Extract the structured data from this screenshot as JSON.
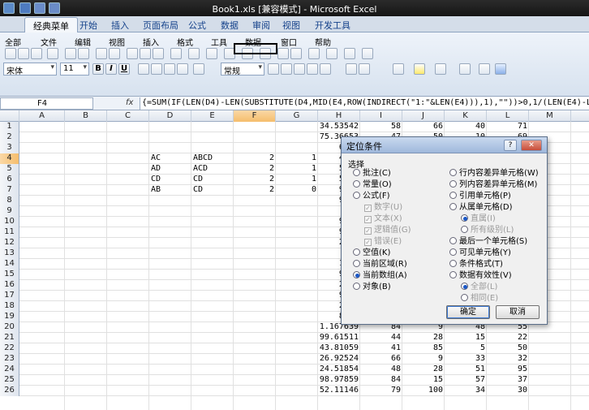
{
  "window": {
    "title": "Book1.xls  [兼容模式] - Microsoft Excel"
  },
  "ribbon_tabs": [
    "经典菜单",
    "开始",
    "插入",
    "页面布局",
    "公式",
    "数据",
    "审阅",
    "视图",
    "开发工具"
  ],
  "menus": [
    "全部",
    "文件",
    "编辑",
    "视图",
    "插入",
    "格式",
    "工具",
    "数据",
    "窗口",
    "帮助"
  ],
  "toolbar": {
    "font_name": "宋体",
    "font_size": "11",
    "number_format": "常规",
    "bold": "B",
    "italic": "I",
    "underline": "U"
  },
  "formula_bar": {
    "cell_ref": "F4",
    "fx": "fx",
    "formula": "{=SUM(IF(LEN(D4)-LEN(SUBSTITUTE(D4,MID(E4,ROW(INDIRECT(\"1:\"&LEN(E4))),1),\"\"))>0,1/(LEN(E4)-LEN"
  },
  "columns": [
    "A",
    "B",
    "C",
    "D",
    "E",
    "F",
    "G",
    "H",
    "I",
    "J",
    "K",
    "L",
    "M"
  ],
  "rows": [
    {
      "n": "1",
      "H": "34.53542",
      "I": "58",
      "J": "66",
      "K": "40",
      "L": "71"
    },
    {
      "n": "2",
      "H": "75.36653",
      "I": "47",
      "J": "50",
      "K": "10",
      "L": "69"
    },
    {
      "n": "3",
      "H": "65.5",
      "I": "",
      "J": "",
      "K": "",
      "L": ""
    },
    {
      "n": "4",
      "D": "AC",
      "E": "ABCD",
      "F": "2",
      "G": "1",
      "H": "47.4",
      "I": "",
      "J": "",
      "K": "",
      "L": ""
    },
    {
      "n": "5",
      "D": "AD",
      "E": "ACD",
      "F": "2",
      "G": "1",
      "H": "59.2",
      "I": "",
      "J": "",
      "K": "",
      "L": ""
    },
    {
      "n": "6",
      "D": "CD",
      "E": "CD",
      "F": "2",
      "G": "1",
      "H": "56.7",
      "I": "",
      "J": "",
      "K": "",
      "L": ""
    },
    {
      "n": "7",
      "D": "AB",
      "E": "CD",
      "F": "2",
      "G": "0",
      "H": "95.1",
      "I": "",
      "J": "",
      "K": "",
      "L": ""
    },
    {
      "n": "8",
      "H": "90.4",
      "I": "",
      "J": "",
      "K": "",
      "L": ""
    },
    {
      "n": "9",
      "H": "64",
      "I": "",
      "J": "",
      "K": "",
      "L": ""
    },
    {
      "n": "10",
      "H": "94.5",
      "I": "",
      "J": "",
      "K": "",
      "L": ""
    },
    {
      "n": "11",
      "H": "96.0",
      "I": "",
      "J": "",
      "K": "",
      "L": ""
    },
    {
      "n": "12",
      "H": "27.5",
      "I": "",
      "J": "",
      "K": "",
      "L": ""
    },
    {
      "n": "13",
      "H": "94.",
      "I": "",
      "J": "",
      "K": "",
      "L": ""
    },
    {
      "n": "14",
      "H": "10.5",
      "I": "",
      "J": "",
      "K": "",
      "L": ""
    },
    {
      "n": "15",
      "H": "94.9",
      "I": "",
      "J": "",
      "K": "",
      "L": ""
    },
    {
      "n": "16",
      "H": "28.0",
      "I": "",
      "J": "",
      "K": "",
      "L": ""
    },
    {
      "n": "17",
      "H": "96.1",
      "I": "",
      "J": "",
      "K": "",
      "L": ""
    },
    {
      "n": "18",
      "H": "24.3",
      "I": "",
      "J": "",
      "K": "",
      "L": ""
    },
    {
      "n": "19",
      "H": "86.2",
      "I": "",
      "J": "",
      "K": "",
      "L": ""
    },
    {
      "n": "20",
      "H": "1.167639",
      "I": "84",
      "J": "9",
      "K": "48",
      "L": "55"
    },
    {
      "n": "21",
      "H": "99.61511",
      "I": "44",
      "J": "28",
      "K": "15",
      "L": "22"
    },
    {
      "n": "22",
      "H": "43.81059",
      "I": "41",
      "J": "85",
      "K": "5",
      "L": "50"
    },
    {
      "n": "23",
      "H": "26.92524",
      "I": "66",
      "J": "9",
      "K": "33",
      "L": "32"
    },
    {
      "n": "24",
      "H": "24.51854",
      "I": "48",
      "J": "28",
      "K": "51",
      "L": "95"
    },
    {
      "n": "25",
      "H": "98.97859",
      "I": "84",
      "J": "15",
      "K": "57",
      "L": "37"
    },
    {
      "n": "26",
      "H": "52.11146",
      "I": "79",
      "J": "100",
      "K": "34",
      "L": "30"
    }
  ],
  "dialog": {
    "title": "定位条件",
    "help": "?",
    "close": "✕",
    "group_label": "选择",
    "left_options": [
      {
        "label": "批注(C)",
        "type": "radio"
      },
      {
        "label": "常量(O)",
        "type": "radio"
      },
      {
        "label": "公式(F)",
        "type": "radio"
      },
      {
        "label": "数字(U)",
        "type": "check",
        "disabled": true
      },
      {
        "label": "文本(X)",
        "type": "check",
        "disabled": true
      },
      {
        "label": "逻辑值(G)",
        "type": "check",
        "disabled": true
      },
      {
        "label": "错误(E)",
        "type": "check",
        "disabled": true
      },
      {
        "label": "空值(K)",
        "type": "radio"
      },
      {
        "label": "当前区域(R)",
        "type": "radio"
      },
      {
        "label": "当前数组(A)",
        "type": "radio",
        "selected": true
      },
      {
        "label": "对象(B)",
        "type": "radio"
      }
    ],
    "right_options": [
      {
        "label": "行内容差异单元格(W)",
        "type": "radio"
      },
      {
        "label": "列内容差异单元格(M)",
        "type": "radio"
      },
      {
        "label": "引用单元格(P)",
        "type": "radio"
      },
      {
        "label": "从属单元格(D)",
        "type": "radio"
      },
      {
        "label": "直属(I)",
        "type": "radio",
        "disabled": true,
        "selected": true
      },
      {
        "label": "所有级别(L)",
        "type": "radio",
        "disabled": true
      },
      {
        "label": "最后一个单元格(S)",
        "type": "radio"
      },
      {
        "label": "可见单元格(Y)",
        "type": "radio"
      },
      {
        "label": "条件格式(T)",
        "type": "radio"
      },
      {
        "label": "数据有效性(V)",
        "type": "radio"
      },
      {
        "label": "全部(L)",
        "type": "radio",
        "disabled": true,
        "selected": true
      },
      {
        "label": "相同(E)",
        "type": "radio",
        "disabled": true
      }
    ],
    "ok": "确定",
    "cancel": "取消"
  }
}
